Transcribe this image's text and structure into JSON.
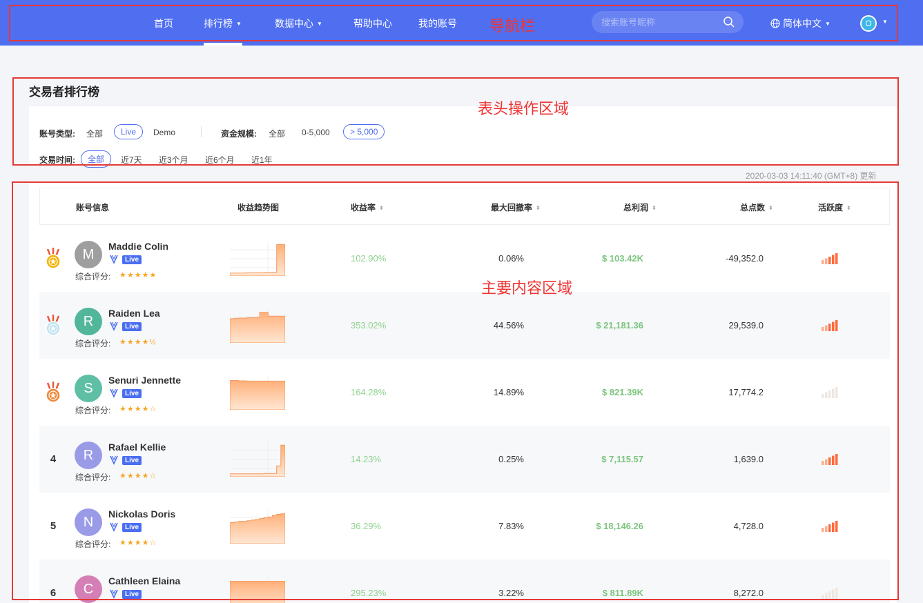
{
  "nav": {
    "items": [
      {
        "label": "首页",
        "caret": ""
      },
      {
        "label": "排行榜",
        "caret": "▼"
      },
      {
        "label": "数据中心",
        "caret": "▼"
      },
      {
        "label": "帮助中心",
        "caret": ""
      },
      {
        "label": "我的账号",
        "caret": ""
      }
    ],
    "annotation": "导航栏",
    "search_placeholder": "搜索账号昵称",
    "language": "简体中文",
    "language_caret": "▼",
    "user_initial": "O",
    "user_caret": "▼"
  },
  "header": {
    "title": "交易者排行榜",
    "annotation": "表头操作区域",
    "account_type": {
      "label": "账号类型:",
      "options": [
        "全部",
        "Live",
        "Demo"
      ],
      "selected": "Live"
    },
    "fund_size": {
      "label": "资金规模:",
      "options": [
        "全部",
        "0-5,000",
        "> 5,000"
      ],
      "selected": "> 5,000"
    },
    "trade_time": {
      "label": "交易时间:",
      "options": [
        "全部",
        "近7天",
        "近3个月",
        "近6个月",
        "近1年"
      ],
      "selected": "全部"
    },
    "updated": "2020-03-03 14:11:40  (GMT+8)  更新"
  },
  "table": {
    "annotation": "主要内容区域",
    "columns": {
      "account": "账号信息",
      "trend": "收益趋势图",
      "return": "收益率",
      "drawdown": "最大回撤率",
      "profit": "总利润",
      "points": "总点数",
      "activity": "活跃度"
    },
    "sort_glyph": "⬍",
    "score_label": "综合评分:",
    "rows": [
      {
        "rank": "1",
        "medal": "gold",
        "initial": "M",
        "avatar_color": "#9e9e9e",
        "name": "Maddie Colin",
        "badge": "Live",
        "stars": "★★★★★",
        "return": "102.90%",
        "drawdown": "0.06%",
        "profit": "$ 103.42K",
        "points": "-49,352.0",
        "activity": 5,
        "trend": [
          0.05,
          0.05,
          0.05,
          0.05,
          0.06,
          0.06,
          0.06,
          0.06,
          0.07,
          0.07,
          0.07,
          0.95,
          0.95,
          0.9
        ]
      },
      {
        "rank": "2",
        "medal": "silver",
        "initial": "R",
        "avatar_color": "#52b69a",
        "name": "Raiden Lea",
        "badge": "Live",
        "stars": "★★★★½",
        "return": "353.02%",
        "drawdown": "44.56%",
        "profit": "$ 21,181.36",
        "points": "29,539.0",
        "activity": 5,
        "trend": [
          0.72,
          0.73,
          0.74,
          0.74,
          0.75,
          0.75,
          0.76,
          0.92,
          0.92,
          0.8,
          0.8,
          0.8,
          0.8,
          0.8
        ]
      },
      {
        "rank": "3",
        "medal": "bronze",
        "initial": "S",
        "avatar_color": "#5fbfa5",
        "name": "Senuri Jennette",
        "badge": "Live",
        "stars": "★★★★☆",
        "return": "164.28%",
        "drawdown": "14.89%",
        "profit": "$ 821.39K",
        "points": "17,774.2",
        "activity": 0,
        "trend": [
          0.88,
          0.88,
          0.87,
          0.87,
          0.86,
          0.86,
          0.86,
          0.86,
          0.86,
          0.86,
          0.86,
          0.86,
          0.86,
          0.86
        ]
      },
      {
        "rank": "4",
        "medal": "",
        "initial": "R",
        "avatar_color": "#9a9be6",
        "name": "Rafael Kellie",
        "badge": "Live",
        "stars": "★★★★☆",
        "return": "14.23%",
        "drawdown": "0.25%",
        "profit": "$ 7,115.57",
        "points": "1,639.0",
        "activity": 5,
        "trend": [
          0.05,
          0.05,
          0.05,
          0.05,
          0.05,
          0.05,
          0.05,
          0.05,
          0.06,
          0.06,
          0.06,
          0.3,
          0.95,
          0.95
        ]
      },
      {
        "rank": "5",
        "medal": "",
        "initial": "N",
        "avatar_color": "#9a9be6",
        "name": "Nickolas Doris",
        "badge": "Live",
        "stars": "★★★★☆",
        "return": "36.29%",
        "drawdown": "7.83%",
        "profit": "$ 18,146.26",
        "points": "4,728.0",
        "activity": 5,
        "trend": [
          0.62,
          0.64,
          0.66,
          0.66,
          0.68,
          0.7,
          0.72,
          0.75,
          0.78,
          0.8,
          0.85,
          0.88,
          0.9,
          0.92
        ]
      },
      {
        "rank": "6",
        "medal": "",
        "initial": "C",
        "avatar_color": "#d47fb6",
        "name": "Cathleen Elaina",
        "badge": "Live",
        "stars": "★★★★☆",
        "return": "295.23%",
        "drawdown": "3.22%",
        "profit": "$ 811.89K",
        "points": "8,272.0",
        "activity": 0,
        "trend": [
          0.88,
          0.88,
          0.88,
          0.88,
          0.88,
          0.88,
          0.88,
          0.88,
          0.88,
          0.88,
          0.88,
          0.88,
          0.88,
          0.88
        ]
      }
    ]
  }
}
